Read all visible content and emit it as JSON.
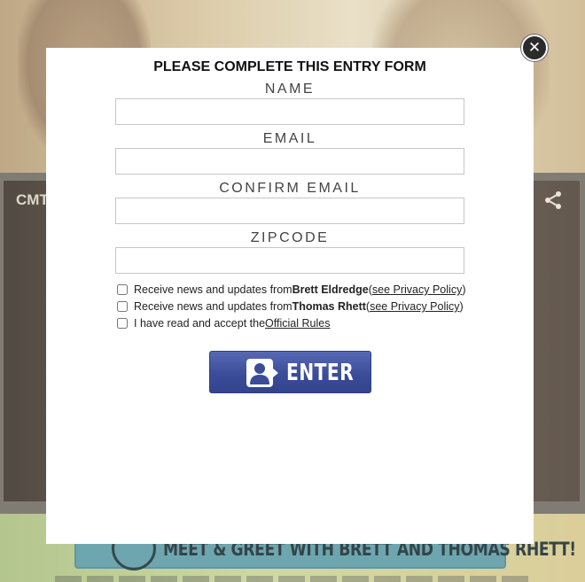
{
  "background": {
    "video_label": "CMT",
    "banner_text": "MEET & GREET WITH BRETT AND THOMAS RHETT!"
  },
  "modal": {
    "title": "PLEASE COMPLETE THIS ENTRY FORM",
    "fields": [
      {
        "label": "NAME",
        "value": "",
        "placeholder": ""
      },
      {
        "label": "EMAIL",
        "value": "",
        "placeholder": ""
      },
      {
        "label": "CONFIRM EMAIL",
        "value": "",
        "placeholder": ""
      },
      {
        "label": "ZIPCODE",
        "value": "",
        "placeholder": ""
      }
    ],
    "checkboxes": [
      {
        "prefix": "Receive news and updates from ",
        "bold": "Brett Eldredge",
        "mid": " (",
        "link": "see Privacy Policy",
        "suffix": ")",
        "checked": false
      },
      {
        "prefix": "Receive news and updates from ",
        "bold": "Thomas Rhett",
        "mid": " (",
        "link": "see Privacy Policy",
        "suffix": ")",
        "checked": false
      },
      {
        "prefix": "I have read and accept the ",
        "link": "Official Rules",
        "checked": false
      }
    ],
    "enter_label": "ENTER",
    "close_icon": "close-icon"
  },
  "colors": {
    "enter_button": "#3b4c99",
    "close_button": "#2b2b2b"
  }
}
